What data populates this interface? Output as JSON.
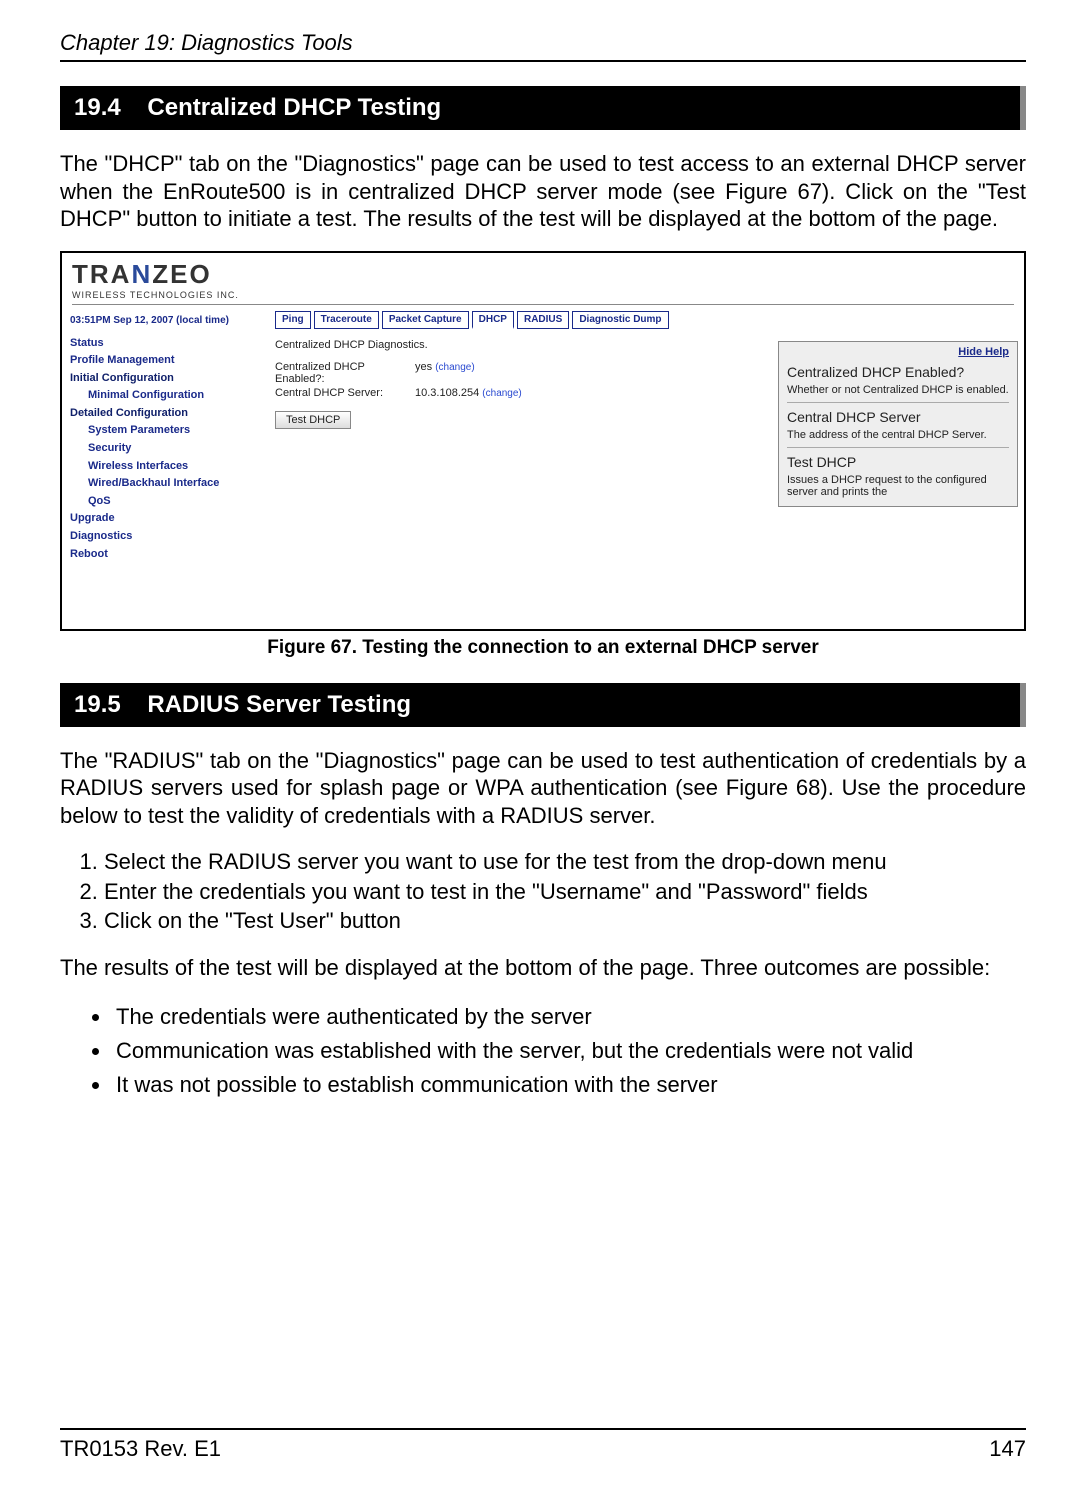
{
  "header": {
    "chapter": "Chapter 19: Diagnostics Tools"
  },
  "section1": {
    "number": "19.4",
    "title": "Centralized DHCP Testing",
    "para": "The \"DHCP\" tab on the \"Diagnostics\" page can be used to test access to an external DHCP server when the EnRoute500 is in centralized DHCP server mode (see Figure 67). Click on the \"Test DHCP\" button to initiate a test. The results of the test will be displayed at the bottom of the page."
  },
  "screenshot": {
    "logo": {
      "pre": "TRA",
      "mid": "N",
      "post": "ZEO",
      "sub": "WIRELESS TECHNOLOGIES INC."
    },
    "timestamp": "03:51PM Sep 12, 2007 (local time)",
    "sidebar": {
      "items": [
        {
          "label": "Status",
          "indent": false,
          "dark": false
        },
        {
          "label": "Profile Management",
          "indent": false,
          "dark": false
        },
        {
          "label": "Initial Configuration",
          "indent": false,
          "dark": true
        },
        {
          "label": "Minimal Configuration",
          "indent": true,
          "dark": false
        },
        {
          "label": "Detailed Configuration",
          "indent": false,
          "dark": true
        },
        {
          "label": "System Parameters",
          "indent": true,
          "dark": false
        },
        {
          "label": "Security",
          "indent": true,
          "dark": false
        },
        {
          "label": "Wireless Interfaces",
          "indent": true,
          "dark": false
        },
        {
          "label": "Wired/Backhaul Interface",
          "indent": true,
          "dark": false
        },
        {
          "label": "QoS",
          "indent": true,
          "dark": false
        },
        {
          "label": "Upgrade",
          "indent": false,
          "dark": false
        },
        {
          "label": "Diagnostics",
          "indent": false,
          "dark": false
        },
        {
          "label": "Reboot",
          "indent": false,
          "dark": false
        }
      ]
    },
    "tabs": [
      "Ping",
      "Traceroute",
      "Packet Capture",
      "DHCP",
      "RADIUS",
      "Diagnostic Dump"
    ],
    "active_tab": "DHCP",
    "diag_title": "Centralized DHCP Diagnostics.",
    "rows": [
      {
        "label": "Centralized DHCP Enabled?:",
        "value": "yes",
        "change": "(change)"
      },
      {
        "label": "Central DHCP Server:",
        "value": "10.3.108.254",
        "change": "(change)"
      }
    ],
    "button": "Test DHCP",
    "help": {
      "hide": "Hide Help",
      "h1": "Centralized DHCP Enabled?",
      "p1": "Whether or not Centralized DHCP is enabled.",
      "h2": "Central DHCP Server",
      "p2": "The address of the central DHCP Server.",
      "h3": "Test DHCP",
      "p3": "Issues a DHCP request to the configured server and prints the"
    }
  },
  "caption1": "Figure 67. Testing the connection to an external DHCP server",
  "section2": {
    "number": "19.5",
    "title": "RADIUS Server Testing",
    "para1": "The \"RADIUS\" tab on the \"Diagnostics\" page can be used to test authentication of credentials by a RADIUS servers used for splash page or WPA authentication (see Figure 68). Use the procedure below to test the validity of credentials with a RADIUS server.",
    "steps": [
      "Select the RADIUS server you want to use for the test from the drop-down menu",
      "Enter the credentials you want to test in the \"Username\" and \"Password\" fields",
      "Click on the \"Test User\" button"
    ],
    "para2": "The results of the test will be displayed at the bottom of the page. Three outcomes are possible:",
    "outcomes": [
      "The credentials were authenticated by the server",
      "Communication was established with the server, but the credentials were not valid",
      "It was not possible to establish communication with the server"
    ]
  },
  "footer": {
    "left": "TR0153 Rev. E1",
    "right": "147"
  }
}
